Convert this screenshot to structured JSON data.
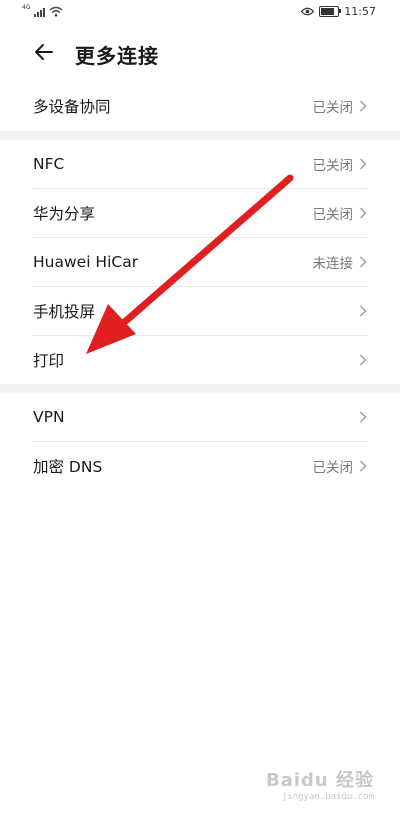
{
  "statusbar": {
    "network": "4G",
    "time": "11:57",
    "battery_level": 0.7
  },
  "header": {
    "title": "更多连接"
  },
  "groups": [
    {
      "items": [
        {
          "label": "多设备协同",
          "status": "已关闭"
        }
      ]
    },
    {
      "items": [
        {
          "label": "NFC",
          "status": "已关闭"
        },
        {
          "label": "华为分享",
          "status": "已关闭"
        },
        {
          "label": "Huawei HiCar",
          "status": "未连接"
        },
        {
          "label": "手机投屏",
          "status": ""
        },
        {
          "label": "打印",
          "status": ""
        }
      ]
    },
    {
      "items": [
        {
          "label": "VPN",
          "status": ""
        },
        {
          "label": "加密 DNS",
          "status": "已关闭"
        }
      ]
    }
  ],
  "annotation": {
    "arrow_color": "#e02020"
  },
  "watermark": {
    "brand": "Baidu 经验",
    "url": "jingyan.baidu.com"
  }
}
